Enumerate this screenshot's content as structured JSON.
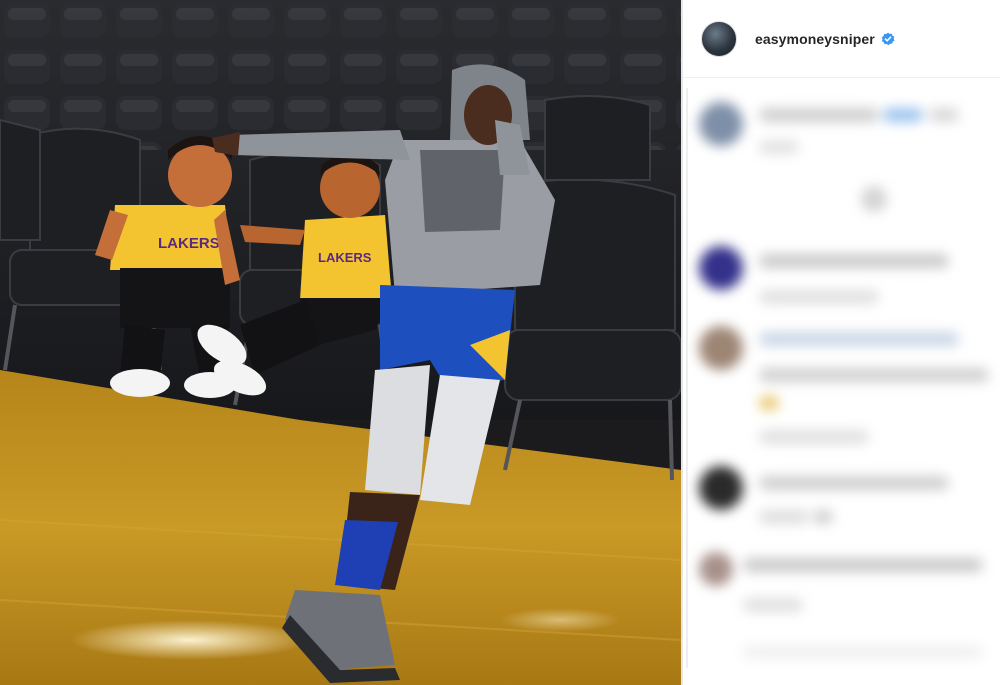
{
  "post": {
    "username": "easymoneysniper",
    "verified": true,
    "avatar": "profile-avatar"
  },
  "photo": {
    "alt_content": "photo",
    "jersey_text_left": "LAKERS",
    "jersey_text_right": "LAKERS"
  },
  "colors": {
    "verified_blue": "#3897f0",
    "floor_gold": "#c9961f",
    "lakers_gold": "#f4c430",
    "warriors_blue": "#1d4fbf"
  },
  "icons": {
    "verified": "verified-badge-icon"
  }
}
